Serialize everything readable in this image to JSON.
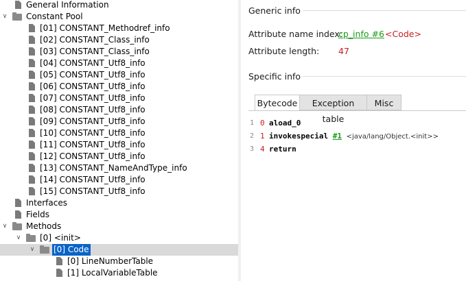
{
  "tree": [
    {
      "label": "General Information",
      "indent": 0,
      "icon": "file",
      "expand": null,
      "selected": false
    },
    {
      "label": "Constant Pool",
      "indent": 0,
      "icon": "folder",
      "expand": "open",
      "selected": false
    },
    {
      "label": "[01] CONSTANT_Methodref_info",
      "indent": 1,
      "icon": "file",
      "expand": null,
      "selected": false
    },
    {
      "label": "[02] CONSTANT_Class_info",
      "indent": 1,
      "icon": "file",
      "expand": null,
      "selected": false
    },
    {
      "label": "[03] CONSTANT_Class_info",
      "indent": 1,
      "icon": "file",
      "expand": null,
      "selected": false
    },
    {
      "label": "[04] CONSTANT_Utf8_info",
      "indent": 1,
      "icon": "file",
      "expand": null,
      "selected": false
    },
    {
      "label": "[05] CONSTANT_Utf8_info",
      "indent": 1,
      "icon": "file",
      "expand": null,
      "selected": false
    },
    {
      "label": "[06] CONSTANT_Utf8_info",
      "indent": 1,
      "icon": "file",
      "expand": null,
      "selected": false
    },
    {
      "label": "[07] CONSTANT_Utf8_info",
      "indent": 1,
      "icon": "file",
      "expand": null,
      "selected": false
    },
    {
      "label": "[08] CONSTANT_Utf8_info",
      "indent": 1,
      "icon": "file",
      "expand": null,
      "selected": false
    },
    {
      "label": "[09] CONSTANT_Utf8_info",
      "indent": 1,
      "icon": "file",
      "expand": null,
      "selected": false
    },
    {
      "label": "[10] CONSTANT_Utf8_info",
      "indent": 1,
      "icon": "file",
      "expand": null,
      "selected": false
    },
    {
      "label": "[11] CONSTANT_Utf8_info",
      "indent": 1,
      "icon": "file",
      "expand": null,
      "selected": false
    },
    {
      "label": "[12] CONSTANT_Utf8_info",
      "indent": 1,
      "icon": "file",
      "expand": null,
      "selected": false
    },
    {
      "label": "[13] CONSTANT_NameAndType_info",
      "indent": 1,
      "icon": "file",
      "expand": null,
      "selected": false
    },
    {
      "label": "[14] CONSTANT_Utf8_info",
      "indent": 1,
      "icon": "file",
      "expand": null,
      "selected": false
    },
    {
      "label": "[15] CONSTANT_Utf8_info",
      "indent": 1,
      "icon": "file",
      "expand": null,
      "selected": false
    },
    {
      "label": "Interfaces",
      "indent": 0,
      "icon": "file",
      "expand": null,
      "selected": false
    },
    {
      "label": "Fields",
      "indent": 0,
      "icon": "file",
      "expand": null,
      "selected": false
    },
    {
      "label": "Methods",
      "indent": 0,
      "icon": "folder",
      "expand": "open",
      "selected": false
    },
    {
      "label": "[0] <init>",
      "indent": 1,
      "icon": "folder",
      "expand": "open",
      "selected": false
    },
    {
      "label": "[0] Code",
      "indent": 2,
      "icon": "folder",
      "expand": "open",
      "selected": true
    },
    {
      "label": "[0] LineNumberTable",
      "indent": 3,
      "icon": "file",
      "expand": null,
      "selected": false
    },
    {
      "label": "[1] LocalVariableTable",
      "indent": 3,
      "icon": "file",
      "expand": null,
      "selected": false
    }
  ],
  "generic": {
    "heading": "Generic info",
    "name_index_label": "Attribute name index:",
    "name_index_link": "cp_info #6",
    "name_index_value": "<Code>",
    "length_label": "Attribute length:",
    "length_value": "47"
  },
  "specific": {
    "heading": "Specific info",
    "tabs": [
      "Bytecode",
      "Exception table",
      "Misc"
    ],
    "active_tab": 0
  },
  "bytecode": [
    {
      "line": "1",
      "offset": "0",
      "op": "aload_0",
      "ref": "",
      "comment": ""
    },
    {
      "line": "2",
      "offset": "1",
      "op": "invokespecial",
      "ref": "#1",
      "comment": "<java/lang/Object.<init>>"
    },
    {
      "line": "3",
      "offset": "4",
      "op": "return",
      "ref": "",
      "comment": ""
    }
  ],
  "colors": {
    "selection": "#0a64c8",
    "link": "#1a9a1a",
    "value": "#c81e1e"
  }
}
